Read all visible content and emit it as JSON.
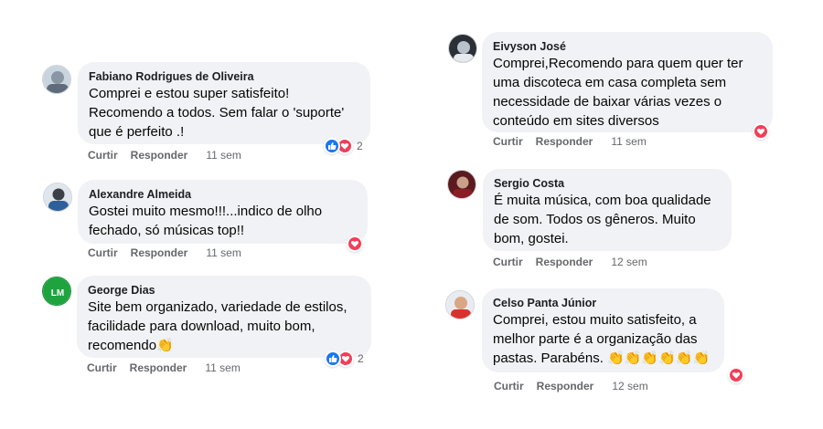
{
  "actions": {
    "like_label": "Curtir",
    "reply_label": "Responder"
  },
  "comments": [
    {
      "author": "Fabiano Rodrigues de Oliveira",
      "lines": [
        "Comprei e estou super satisfeito!",
        "Recomendo a todos. Sem falar o 'suporte'",
        "que é perfeito .!"
      ],
      "time": "11 sem",
      "reactions": {
        "types": [
          "like-icon",
          "love-icon"
        ],
        "count": "2"
      }
    },
    {
      "author": "Alexandre Almeida",
      "lines": [
        "Gostei muito mesmo!!!...indico de olho",
        "fechado, só músicas top!!"
      ],
      "time": "11 sem",
      "reactions": {
        "types": [
          "love-icon"
        ],
        "count": ""
      }
    },
    {
      "author": "George Dias",
      "lines": [
        "Site bem organizado, variedade de estilos,",
        "facilidade para download, muito bom,",
        "recomendo👏"
      ],
      "time": "11 sem",
      "reactions": {
        "types": [
          "like-icon",
          "love-icon"
        ],
        "count": "2"
      }
    },
    {
      "author": "Eivyson José",
      "lines": [
        "Comprei,Recomendo para quem quer ter",
        "uma discoteca em casa completa sem",
        "necessidade de baixar várias vezes o",
        "conteúdo em sites diversos"
      ],
      "time": "11 sem",
      "reactions": {
        "types": [
          "love-icon"
        ],
        "count": ""
      }
    },
    {
      "author": "Sergio Costa",
      "lines": [
        "É muita música, com boa qualidade",
        "de som. Todos os gêneros. Muito",
        "bom, gostei."
      ],
      "time": "12 sem",
      "reactions": {
        "types": [],
        "count": ""
      }
    },
    {
      "author": "Celso Panta Júnior",
      "lines": [
        "Comprei, estou muito satisfeito, a",
        "melhor parte é a organização das",
        "pastas. Parabéns. 👏👏👏👏👏👏"
      ],
      "time": "12 sem",
      "reactions": {
        "types": [
          "love-icon"
        ],
        "count": ""
      }
    }
  ],
  "colors": {
    "bubble": "#f0f2f5",
    "like": "#1877f2",
    "love": "#f33e58",
    "meta": "#65676b"
  }
}
